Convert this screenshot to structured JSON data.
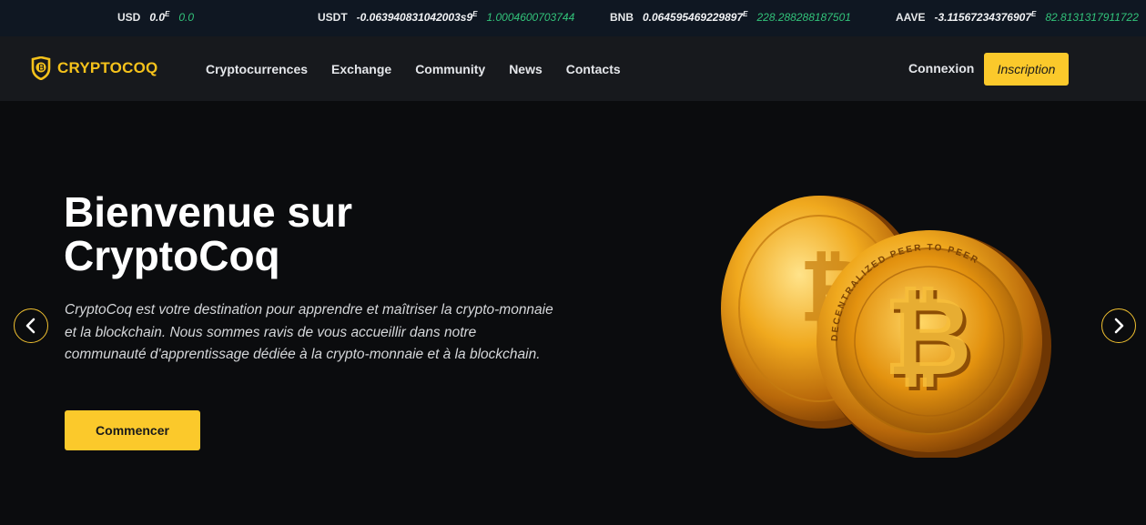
{
  "ticker": [
    {
      "symbol": "USD",
      "price": "0.0",
      "exponent": "E",
      "change": "0.0"
    },
    {
      "symbol": "USDT",
      "price": "-0.063940831042003s9",
      "exponent": "E",
      "change": "1.0004600703744"
    },
    {
      "symbol": "BNB",
      "price": "0.064595469229897",
      "exponent": "E",
      "change": "228.288288187501"
    },
    {
      "symbol": "AAVE",
      "price": "-3.11567234376907",
      "exponent": "E",
      "change": "82.8131317911722"
    }
  ],
  "brand": {
    "name": "CRYPTOCOQ",
    "color": "#f5c21b",
    "icon": "shield-coin-icon"
  },
  "nav": {
    "links": [
      "Cryptocurrences",
      "Exchange",
      "Community",
      "News",
      "Contacts"
    ]
  },
  "auth": {
    "login_label": "Connexion",
    "signup_label": "Inscription"
  },
  "hero": {
    "title": "Bienvenue sur CryptoCoq",
    "description": "CryptoCoq est votre destination pour apprendre et maîtriser la crypto-monnaie et la blockchain. Nous sommes ravis de vous accueillir dans notre communauté d'apprentissage dédiée à la crypto-monnaie et à la blockchain.",
    "cta_label": "Commencer",
    "coin_ring_text": "DECENTRALIZED PEER TO PEER",
    "image": "bitcoin-coins-image"
  },
  "carousel": {
    "prev_icon": "chevron-left-icon",
    "next_icon": "chevron-right-icon"
  },
  "colors": {
    "accent": "#fbc92b",
    "positive": "#32c37a",
    "ticker_bg": "#0f1722",
    "nav_bg": "#17191d",
    "hero_bg": "#0b0c0e"
  }
}
